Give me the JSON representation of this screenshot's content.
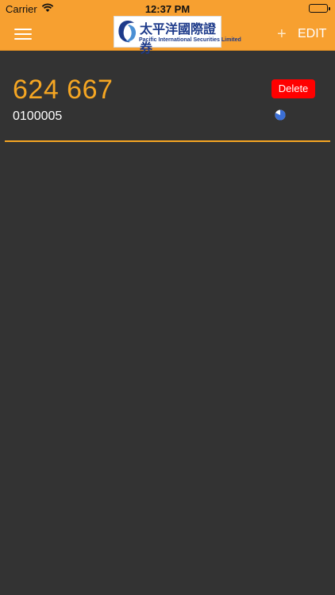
{
  "status_bar": {
    "carrier": "Carrier",
    "time": "12:37 PM"
  },
  "nav": {
    "edit_label": "EDIT",
    "add_label": "+",
    "logo": {
      "chinese_name": "太平洋國際證券",
      "english_name": "Pacific International Securities Limited"
    }
  },
  "entry": {
    "number": "624 667",
    "code": "0100005",
    "delete_label": "Delete"
  },
  "colors": {
    "nav_background": "#f7a030",
    "accent": "#f5a623",
    "page_background": "#333333",
    "delete": "#ff0000"
  }
}
